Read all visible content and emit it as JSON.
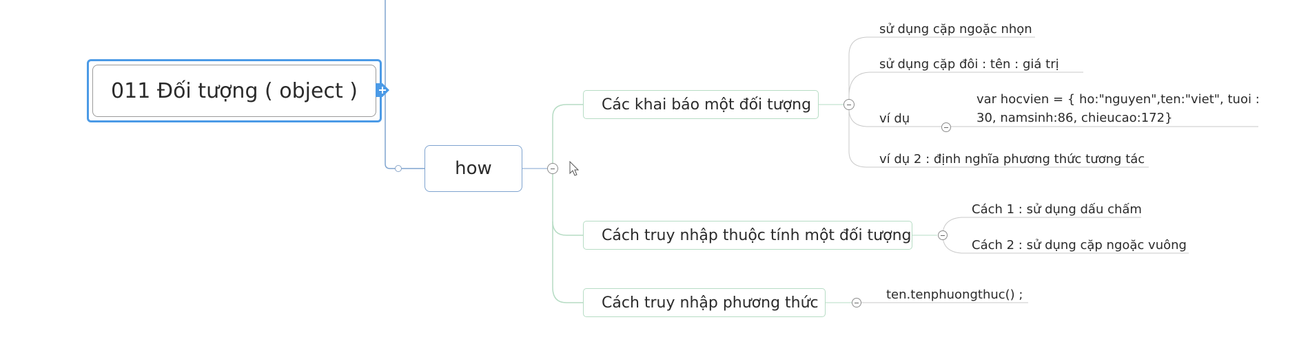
{
  "root": {
    "title": "011 Đối tượng ( object )"
  },
  "how": {
    "label": "how"
  },
  "branches": [
    {
      "label": "Các khai báo một đối tượng"
    },
    {
      "label": "Cách truy nhập thuộc tính một đối tượng"
    },
    {
      "label": "Cách truy nhập phương thức"
    }
  ],
  "leaves": {
    "declare": [
      "sử dụng cặp ngoặc nhọn",
      "sử dụng cặp đôi : tên : giá trị",
      "ví dụ",
      "ví dụ 2 : định nghĩa phương thức tương tác"
    ],
    "example": "var  hocvien = { ho:\"nguyen\",ten:\"viet\", tuoi : 30, namsinh:86, chieucao:172}",
    "access": [
      "Cách 1 : sử dụng dấu chấm",
      "Cách 2 : sử dụng cặp ngoặc vuông"
    ],
    "method": "ten.tenphuongthuc() ;"
  },
  "colors": {
    "root_border": "#4b9ae6",
    "branch_line": "#b6dcc4",
    "leaf_line": "#c9c9c9"
  }
}
